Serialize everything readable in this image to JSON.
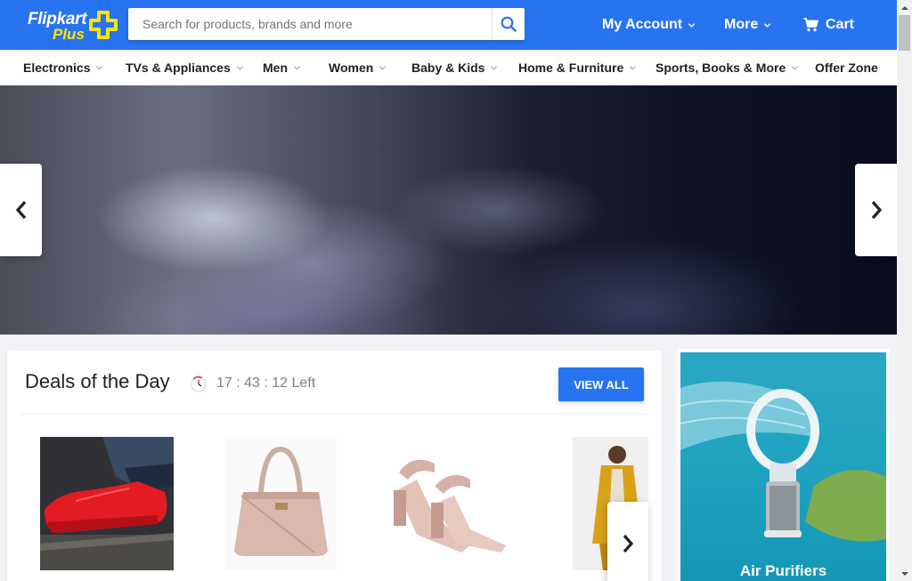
{
  "header": {
    "logo_text": "Flipkart",
    "logo_sub": "Plus",
    "search_placeholder": "Search for products, brands and more",
    "my_account": "My Account",
    "more": "More",
    "cart": "Cart"
  },
  "categories": [
    "Electronics",
    "TVs & Appliances",
    "Men",
    "Women",
    "Baby & Kids",
    "Home & Furniture",
    "Sports, Books & More",
    "Offer Zone"
  ],
  "deals": {
    "title": "Deals of the Day",
    "timer": "17 : 43 : 12 Left",
    "view_all": "VIEW ALL"
  },
  "ad": {
    "label": "Air Purifiers"
  },
  "colors": {
    "brand_blue": "#2874f0",
    "logo_yellow": "#ffe500",
    "page_bg": "#f1f3f6"
  }
}
